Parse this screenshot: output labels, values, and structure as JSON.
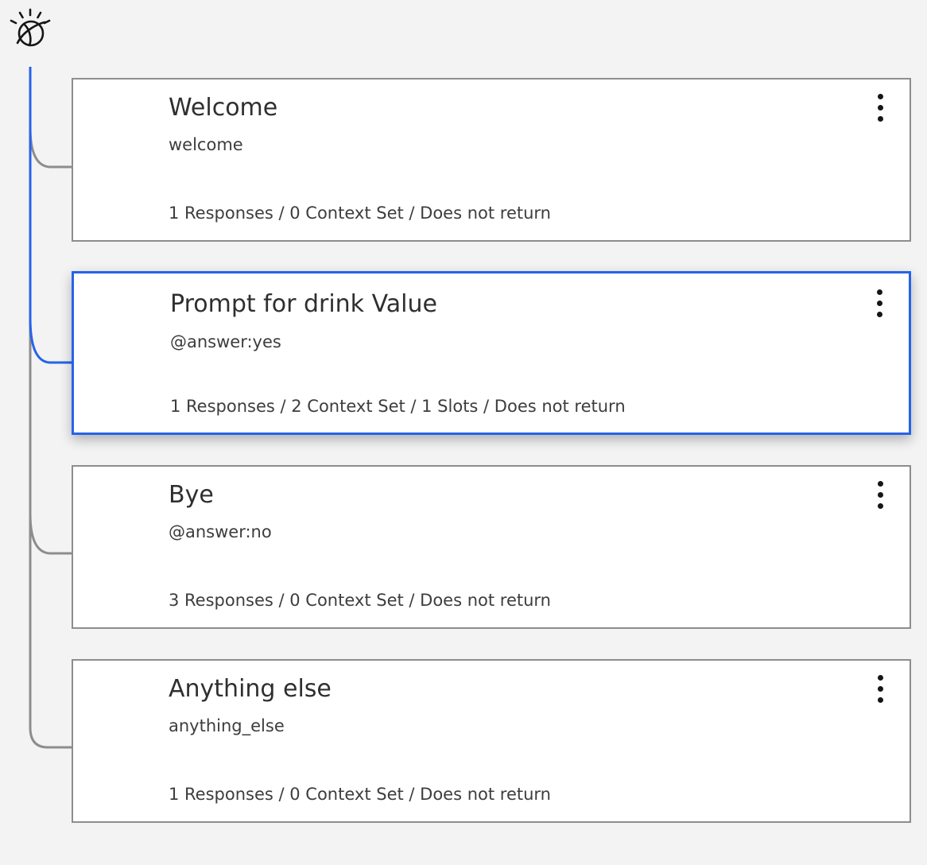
{
  "logo": {
    "icon": "ibm-watson-logo-icon"
  },
  "colors": {
    "selected_border": "#2563eb",
    "tree_line": "#8d8d8d",
    "active_branch": "#2563eb"
  },
  "nodes": [
    {
      "title": "Welcome",
      "condition": "welcome",
      "summary": "1 Responses / 0 Context Set / Does not return",
      "selected": false,
      "menu_icon": "overflow-menu-vertical-icon"
    },
    {
      "title": "Prompt for drink Value",
      "condition": "@answer:yes",
      "summary": "1 Responses / 2 Context Set / 1 Slots / Does not return",
      "selected": true,
      "menu_icon": "overflow-menu-vertical-icon"
    },
    {
      "title": "Bye",
      "condition": "@answer:no",
      "summary": "3 Responses / 0 Context Set / Does not return",
      "selected": false,
      "menu_icon": "overflow-menu-vertical-icon"
    },
    {
      "title": "Anything else",
      "condition": "anything_else",
      "summary": "1 Responses / 0 Context Set / Does not return",
      "selected": false,
      "menu_icon": "overflow-menu-vertical-icon"
    }
  ]
}
